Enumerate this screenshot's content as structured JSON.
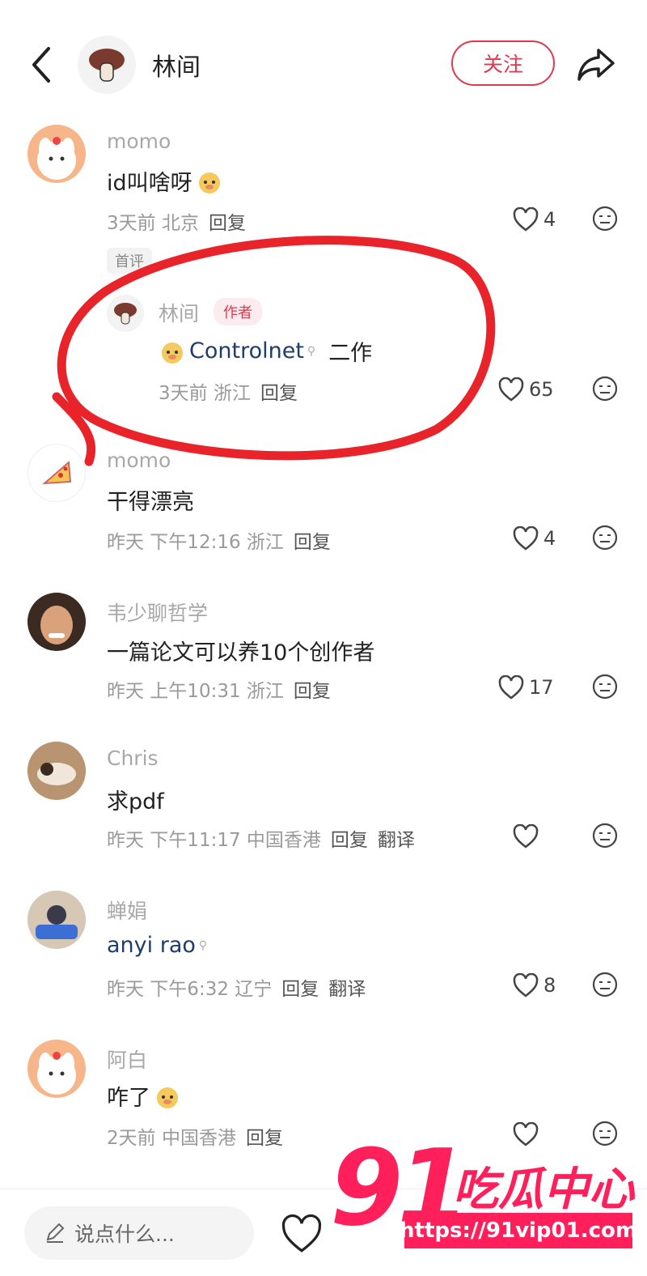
{
  "header": {
    "title": "林间",
    "follow_label": "关注",
    "back_icon": "chevron-left-icon",
    "share_icon": "share-icon"
  },
  "comments": [
    {
      "name": "momo",
      "text": "id叫啥呀",
      "meta": "3天前 北京",
      "reply": "回复",
      "likes": "4",
      "badge": "首评"
    },
    {
      "name": "林间",
      "author_tag": "作者",
      "mention": "Controlnet",
      "text": "二作",
      "meta": "3天前 浙江",
      "reply": "回复",
      "likes": "65"
    },
    {
      "name": "momo",
      "text": "干得漂亮",
      "meta": "昨天 下午12:16 浙江",
      "reply": "回复",
      "likes": "4"
    },
    {
      "name": "韦少聊哲学",
      "text": "一篇论文可以养10个创作者",
      "meta": "昨天 上午10:31 浙江",
      "reply": "回复",
      "likes": "17"
    },
    {
      "name": "Chris",
      "text": "求pdf",
      "meta": "昨天 下午11:17 中国香港",
      "reply": "回复",
      "translate": "翻译",
      "likes": ""
    },
    {
      "name": "蝉娟",
      "mention": "anyi rao",
      "meta": "昨天 下午6:32 辽宁",
      "reply": "回复",
      "translate": "翻译",
      "likes": "8"
    },
    {
      "name": "阿白",
      "text": "咋了",
      "meta": "2天前 中国香港",
      "reply": "回复",
      "likes": ""
    }
  ],
  "bottom": {
    "placeholder": "说点什么...",
    "like_icon": "heart-outline-icon"
  },
  "watermark": {
    "number": "91",
    "text": "吃瓜中心",
    "url": "https://91vip01.com"
  },
  "colors": {
    "accent": "#e0384f",
    "annotation": "#e8232a",
    "watermark": "#ff1f5a"
  }
}
